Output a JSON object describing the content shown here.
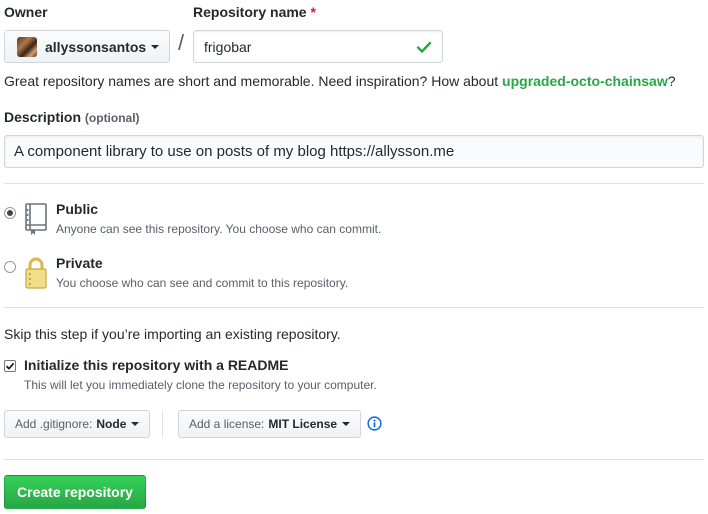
{
  "owner": {
    "label": "Owner",
    "selected": "allyssonsantos"
  },
  "repo_name": {
    "label": "Repository name",
    "required_mark": "*",
    "value": "frigobar",
    "separator": "/"
  },
  "hint": {
    "text": "Great repository names are short and memorable. Need inspiration? How about ",
    "suggestion": "upgraded-octo-chainsaw",
    "suffix": "?"
  },
  "description": {
    "label": "Description",
    "optional": "(optional)",
    "value": "A component library to use on posts of my blog https://allysson.me"
  },
  "visibility": {
    "public": {
      "title": "Public",
      "note": "Anyone can see this repository. You choose who can commit.",
      "checked": true,
      "icon": "repo-book-icon"
    },
    "private": {
      "title": "Private",
      "note": "You choose who can see and commit to this repository.",
      "checked": false,
      "icon": "lock-icon"
    }
  },
  "import_note": "Skip this step if you’re importing an existing repository.",
  "readme": {
    "label": "Initialize this repository with a README",
    "note": "This will let you immediately clone the repository to your computer.",
    "checked": true
  },
  "gitignore": {
    "prefix": "Add .gitignore:",
    "value": "Node"
  },
  "license": {
    "prefix": "Add a license:",
    "value": "MIT License"
  },
  "create_button": "Create repository",
  "colors": {
    "success": "#28a745",
    "required": "#cb2431",
    "info": "#0366d6"
  }
}
